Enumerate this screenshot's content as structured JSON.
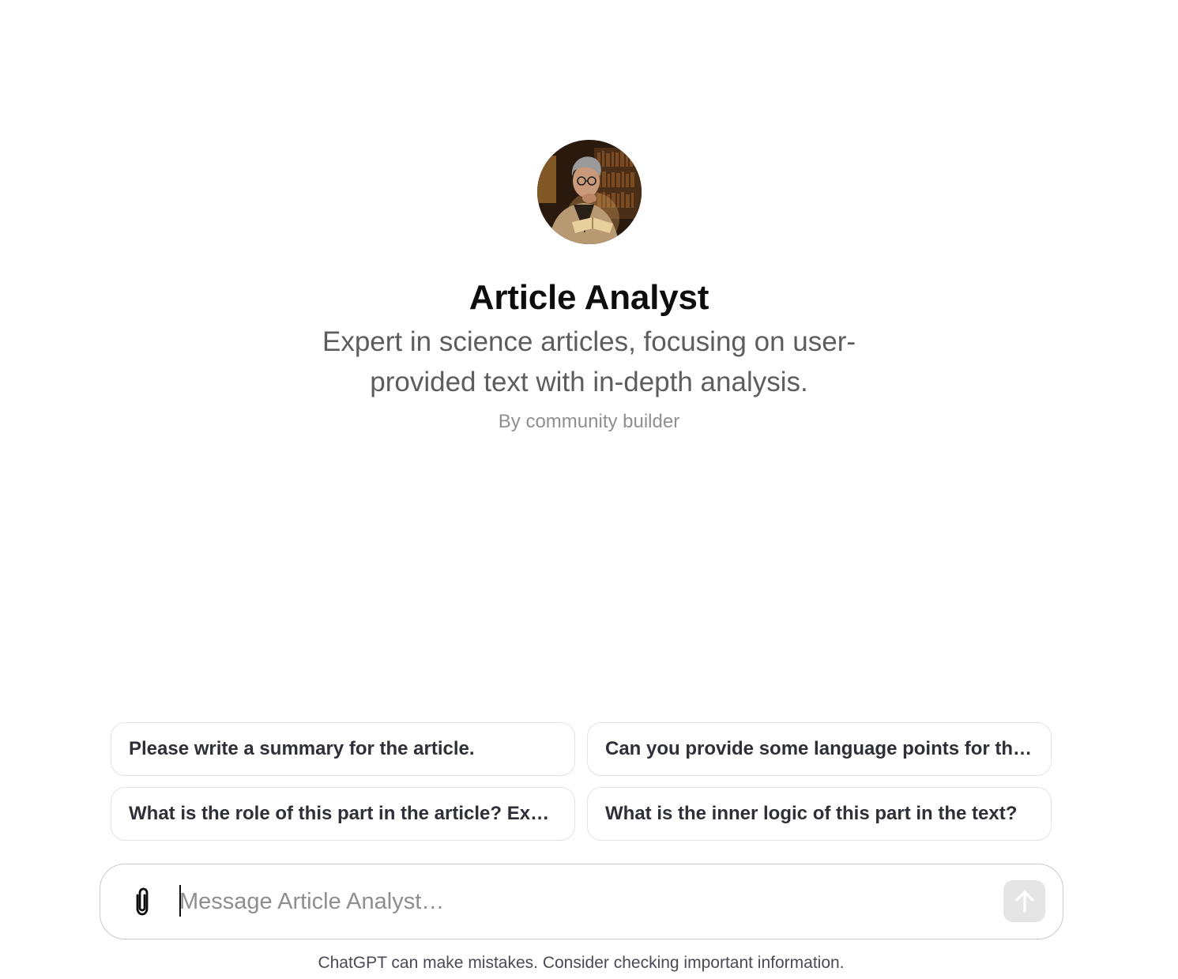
{
  "gpt": {
    "name": "Article Analyst",
    "description": "Expert in science articles, focusing on user-provided text with in-depth analysis.",
    "author": "By community builder",
    "avatar_icon": "scholar-reading-avatar"
  },
  "suggestions": [
    {
      "label": "Please write a summary for the article."
    },
    {
      "label": "Can you provide some language points for this article?"
    },
    {
      "label": "What is the role of this part in the article? Explain it."
    },
    {
      "label": "What is the inner logic of this part in the text?"
    }
  ],
  "composer": {
    "placeholder": "Message Article Analyst…",
    "value": "",
    "attach_icon": "paperclip-icon",
    "send_icon": "arrow-up-icon"
  },
  "footer": {
    "disclaimer": "ChatGPT can make mistakes. Consider checking important information."
  },
  "colors": {
    "title": "#0d0d0d",
    "description": "#5d5d5d",
    "author": "#8f8f8f",
    "suggestion_border": "#e3e3e3",
    "send_disabled_bg": "#e5e5e5"
  }
}
